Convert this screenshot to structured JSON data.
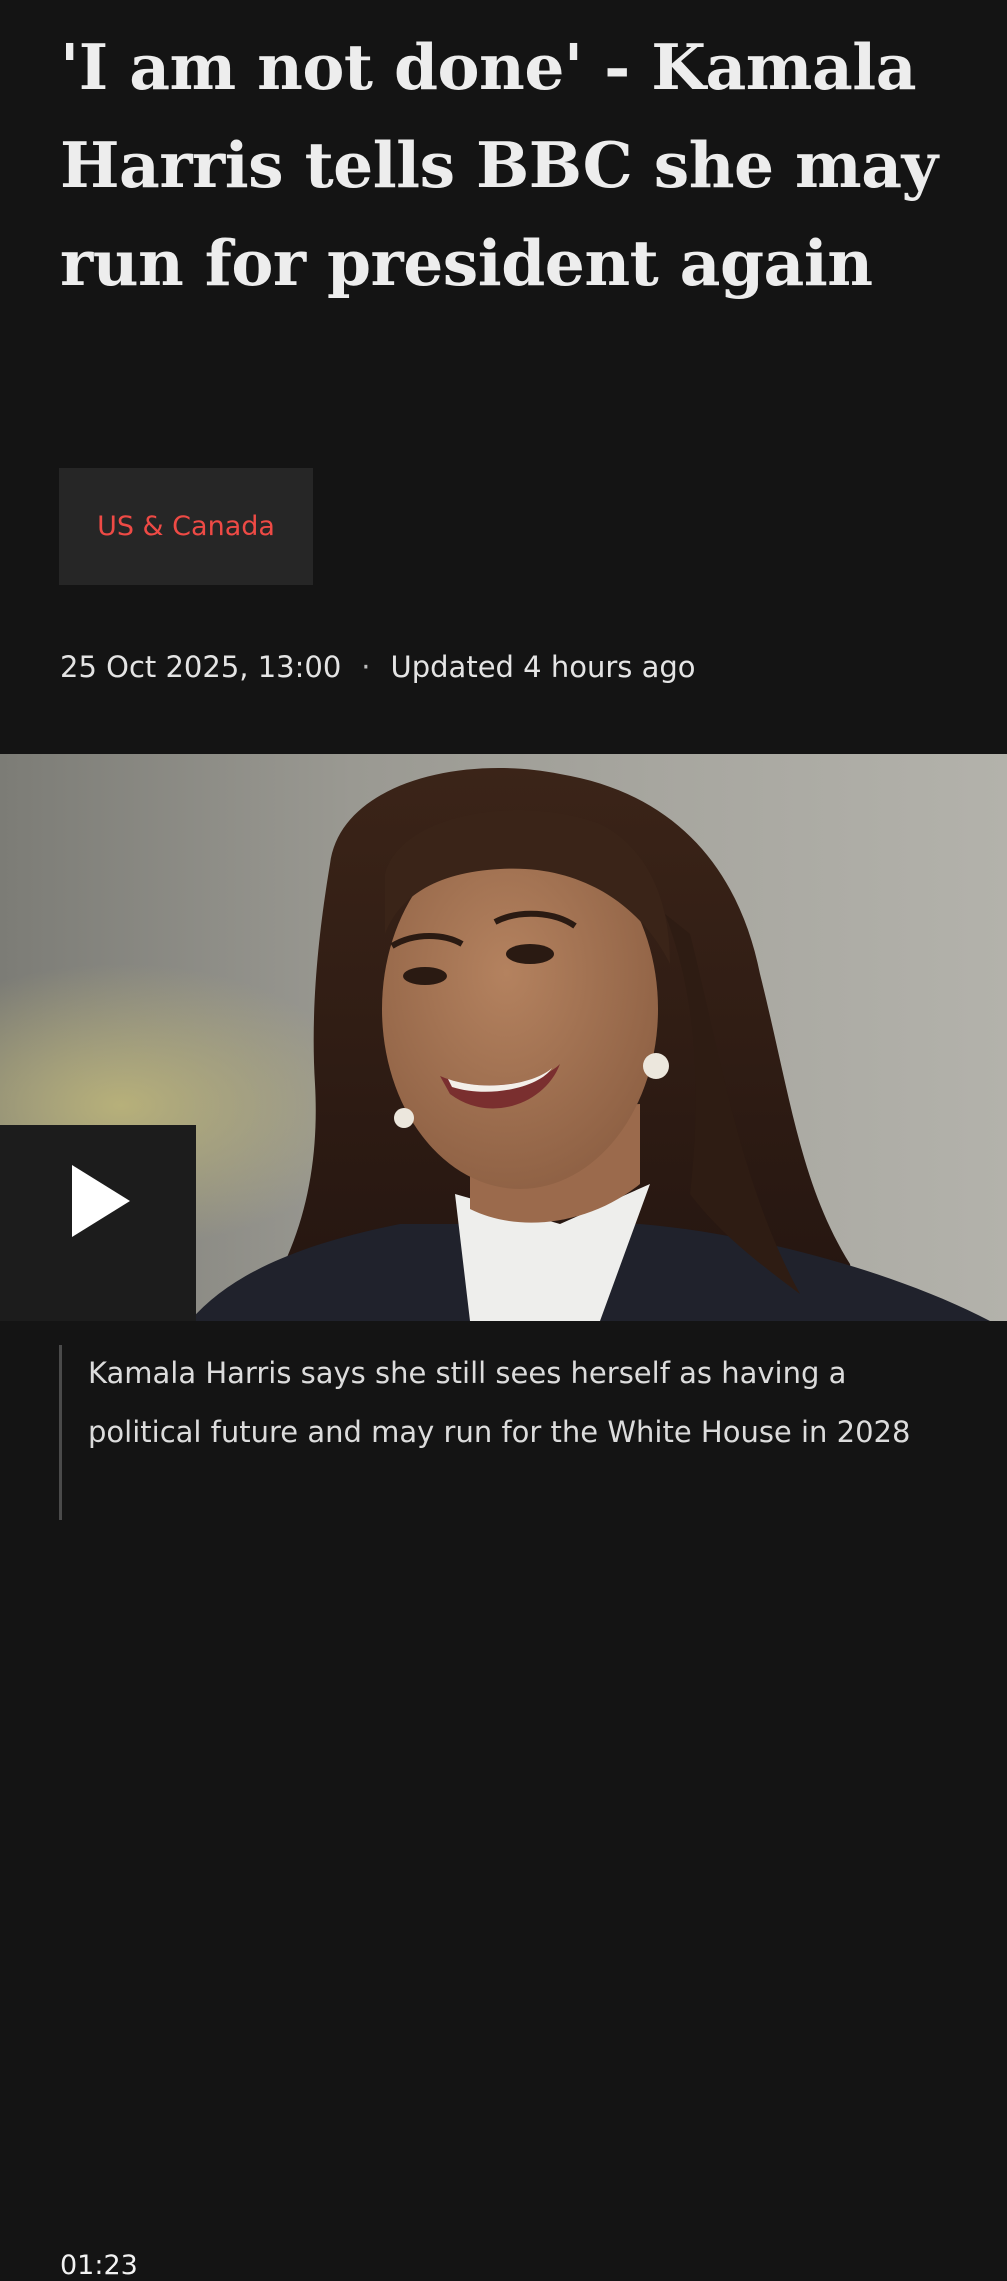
{
  "article": {
    "headline": "'I am not done' - Kamala Harris tells BBC she may run for president again",
    "topic_tag": "US & Canada",
    "published": "25 Oct 2025, 13:00",
    "separator": "·",
    "updated": "Updated 4 hours ago"
  },
  "media": {
    "play_icon": "play-icon",
    "duration": "01:23",
    "caption": "Kamala Harris says she still sees herself as having a political future and may run for the White House in 2028"
  },
  "colors": {
    "background": "#141414",
    "headline_text": "#ededed",
    "topic_tag_bg": "#262626",
    "topic_tag_text": "#ee4a45",
    "caption_border": "#4a4a4a"
  }
}
